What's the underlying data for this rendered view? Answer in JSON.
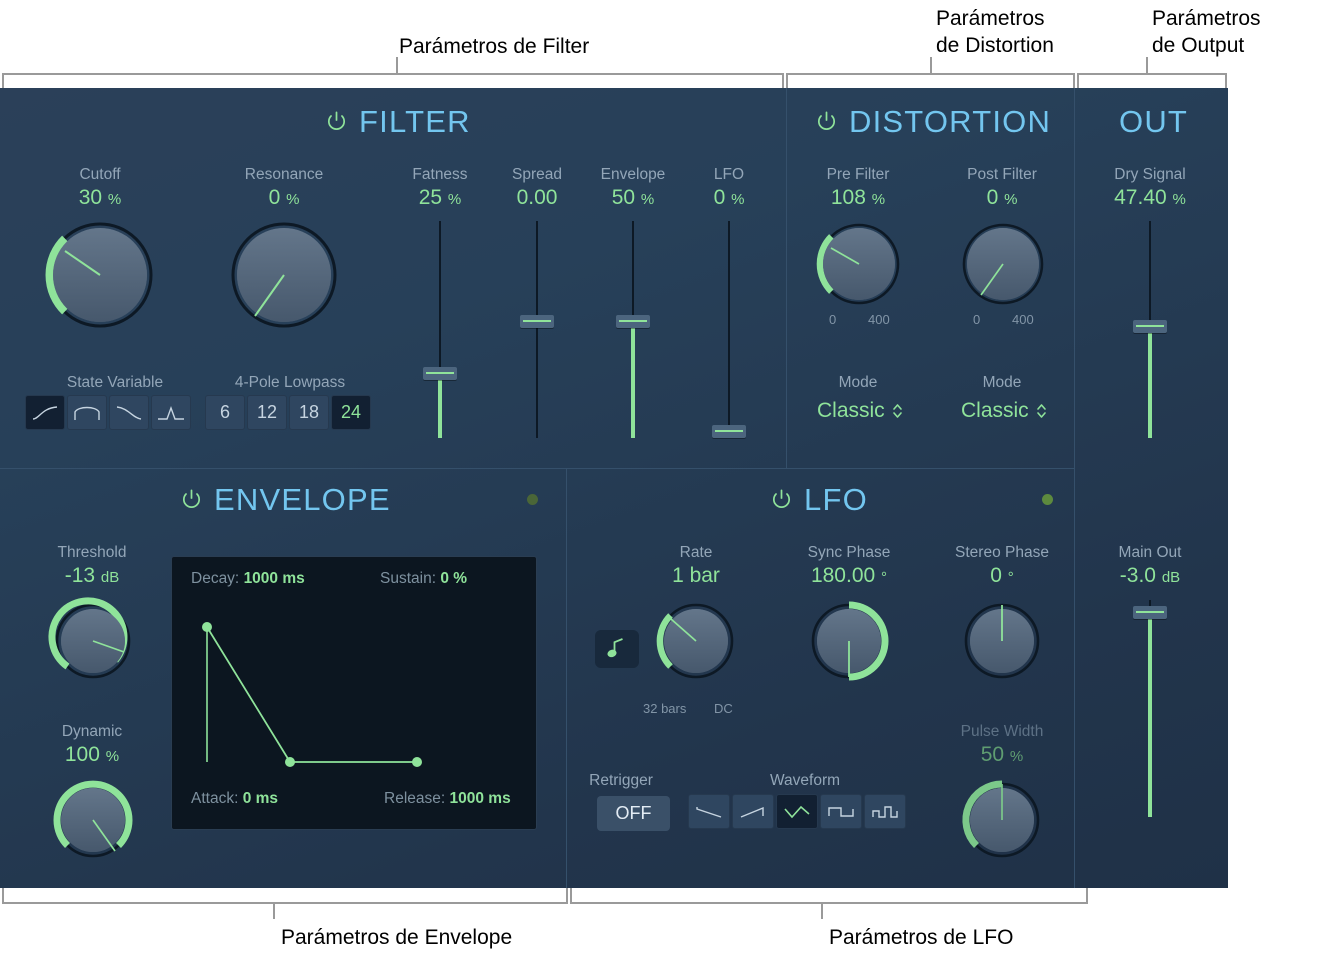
{
  "annotations": [
    {
      "key": "filter",
      "text": "Parámetros de Filter"
    },
    {
      "key": "distortion",
      "text": "Parámetros\nde Distortion"
    },
    {
      "key": "output",
      "text": "Parámetros\nde Output"
    },
    {
      "key": "envelope",
      "text": "Parámetros de Envelope"
    },
    {
      "key": "lfo",
      "text": "Parámetros de LFO"
    }
  ],
  "filter": {
    "title": "FILTER",
    "cutoff": {
      "name": "Cutoff",
      "value": "30",
      "unit": "%"
    },
    "resonance": {
      "name": "Resonance",
      "value": "0",
      "unit": "%"
    },
    "fatness": {
      "name": "Fatness",
      "value": "25",
      "unit": "%"
    },
    "spread": {
      "name": "Spread",
      "value": "0.00",
      "unit": ""
    },
    "envelope": {
      "name": "Envelope",
      "value": "50",
      "unit": "%"
    },
    "lfo": {
      "name": "LFO",
      "value": "0",
      "unit": "%"
    },
    "mode_label": "State Variable",
    "slope_label": "4-Pole Lowpass",
    "shapes": [
      "highpass",
      "bandpass",
      "lowpass",
      "peak"
    ],
    "shape_selected": 0,
    "slopes": [
      "6",
      "12",
      "18",
      "24"
    ],
    "slope_selected": 3
  },
  "distortion": {
    "title": "DISTORTION",
    "pre": {
      "name": "Pre Filter",
      "value": "108",
      "unit": "%",
      "min": "0",
      "max": "400",
      "mode_label": "Mode",
      "mode": "Classic"
    },
    "post": {
      "name": "Post Filter",
      "value": "0",
      "unit": "%",
      "min": "0",
      "max": "400",
      "mode_label": "Mode",
      "mode": "Classic"
    }
  },
  "output": {
    "title": "OUT",
    "dry": {
      "name": "Dry Signal",
      "value": "47.40",
      "unit": "%"
    },
    "main": {
      "name": "Main Out",
      "value": "-3.0",
      "unit": "dB"
    }
  },
  "envelope": {
    "title": "ENVELOPE",
    "threshold": {
      "name": "Threshold",
      "value": "-13",
      "unit": "dB"
    },
    "dynamic": {
      "name": "Dynamic",
      "value": "100",
      "unit": "%"
    },
    "display": {
      "decay_label": "Decay:",
      "decay_value": "1000 ms",
      "sustain_label": "Sustain:",
      "sustain_value": "0 %",
      "attack_label": "Attack:",
      "attack_value": "0 ms",
      "release_label": "Release:",
      "release_value": "1000 ms"
    }
  },
  "lfo": {
    "title": "LFO",
    "note_button": "note-icon",
    "rate": {
      "name": "Rate",
      "value": "1 bar",
      "min": "32 bars",
      "max": "DC"
    },
    "sync_phase": {
      "name": "Sync Phase",
      "value": "180.00",
      "unit": "°"
    },
    "stereo_phase": {
      "name": "Stereo Phase",
      "value": "0",
      "unit": "°"
    },
    "pulse_width": {
      "name": "Pulse Width",
      "value": "50",
      "unit": "%"
    },
    "retrigger_label": "Retrigger",
    "retrigger_value": "OFF",
    "waveform_label": "Waveform",
    "waveforms": [
      "saw-down",
      "saw-up",
      "triangle",
      "square",
      "pulse"
    ],
    "waveform_selected": 2
  },
  "colors": {
    "accent_green": "#8fe39a",
    "title_blue": "#73c6ef",
    "panel_bg": "#274059",
    "label_gray": "#93a6b8"
  }
}
